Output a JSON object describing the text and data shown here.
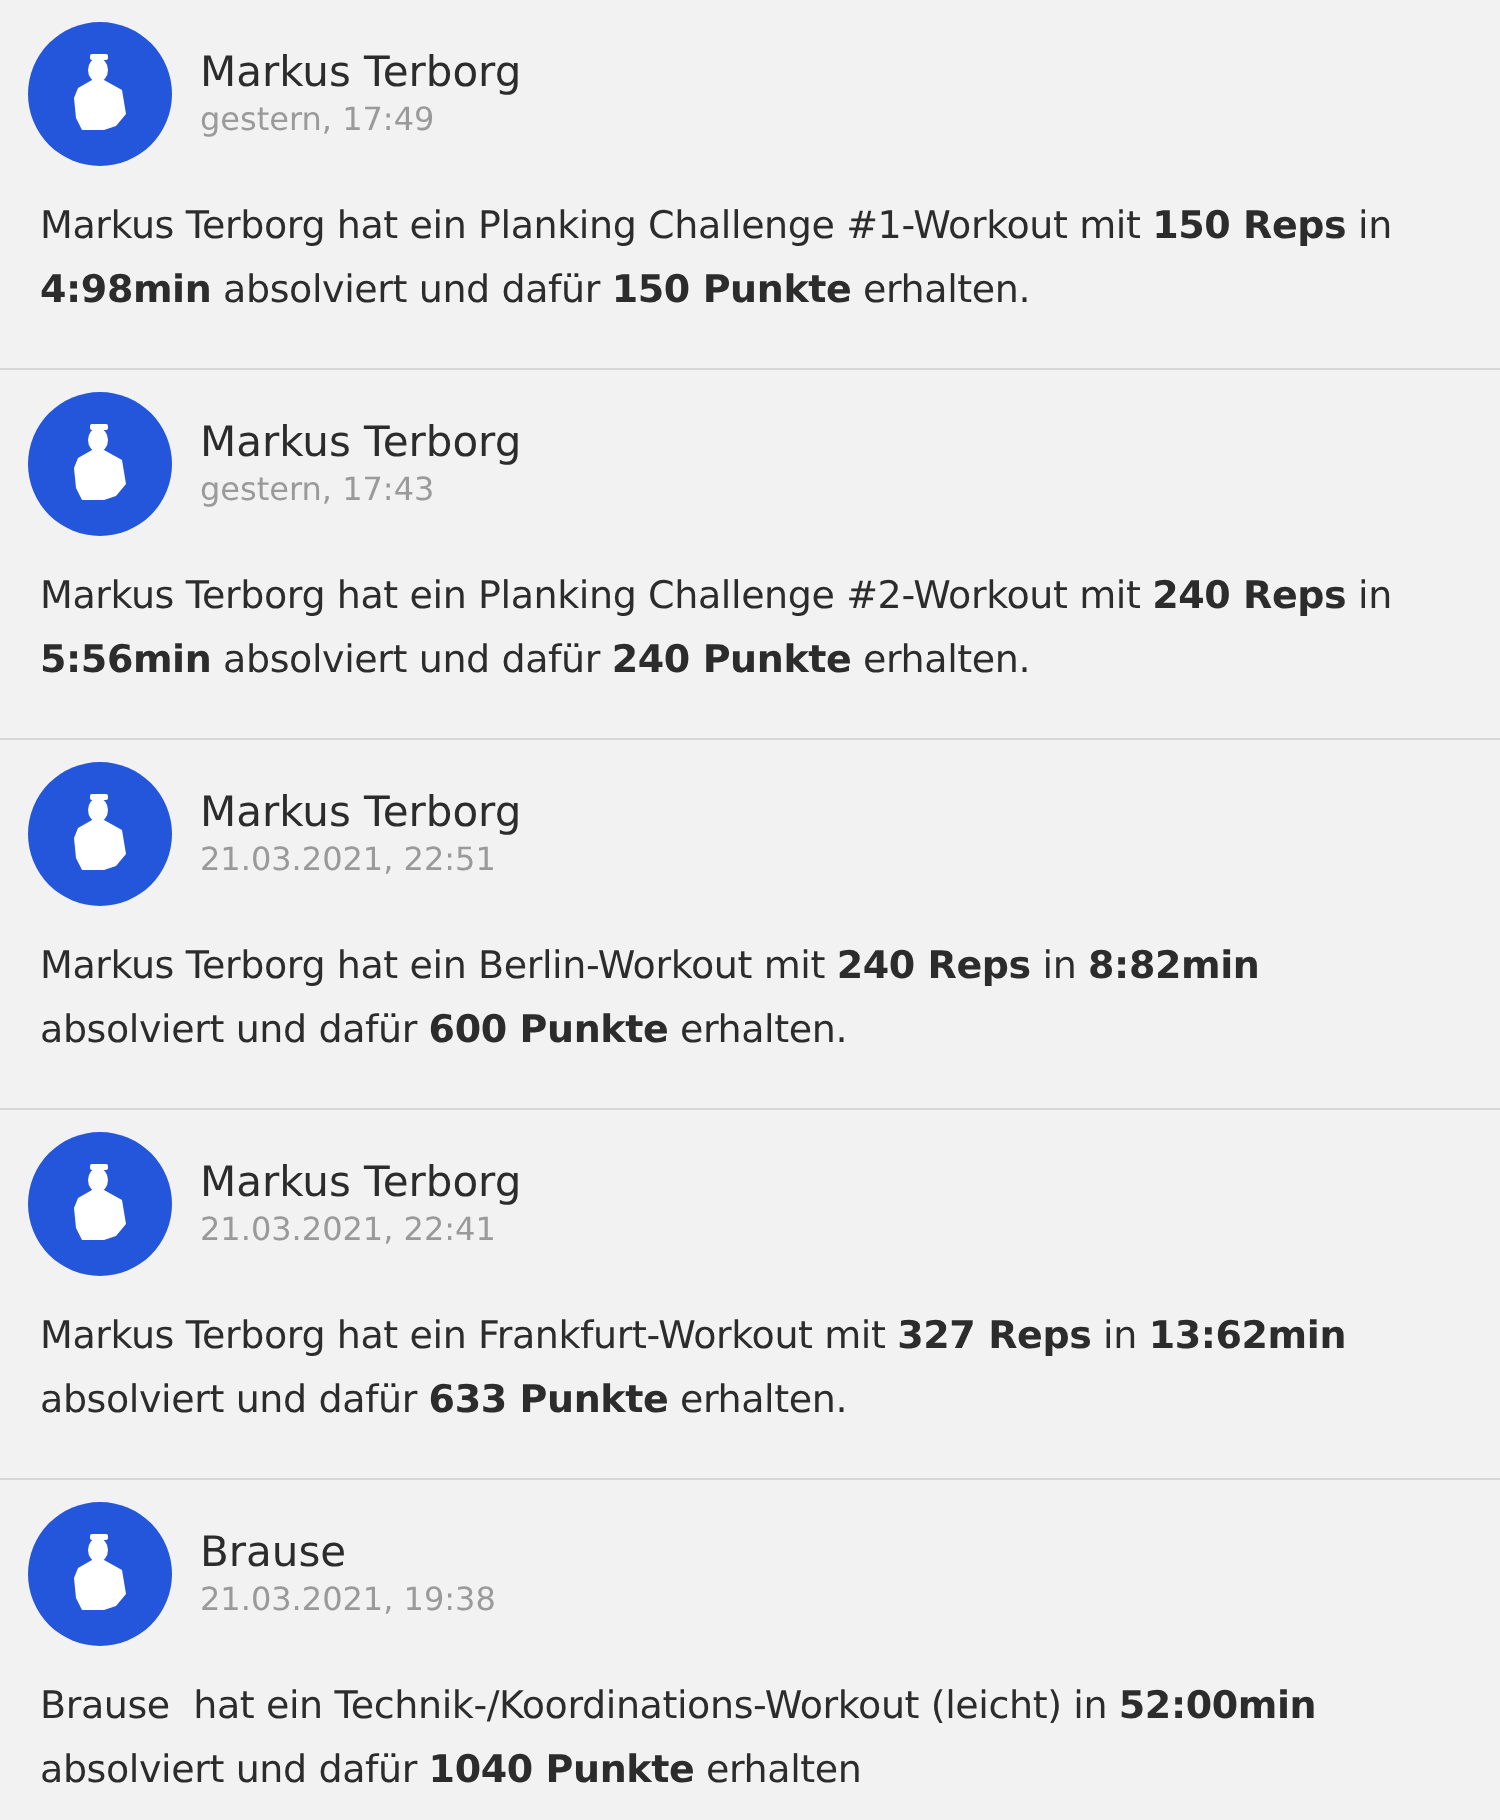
{
  "posts": [
    {
      "author": "Markus Terborg",
      "time": "gestern, 17:49",
      "text": "Markus Terborg hat ein Planking Challenge #1-Workout mit **150 Reps** in **4:98min** absolviert und dafür **150 Punkte** erhalten."
    },
    {
      "author": "Markus Terborg",
      "time": "gestern, 17:43",
      "text": "Markus Terborg hat ein Planking Challenge #2-Workout mit **240 Reps** in **5:56min** absolviert und dafür **240 Punkte** erhalten."
    },
    {
      "author": "Markus Terborg",
      "time": "21.03.2021, 22:51",
      "text": "Markus Terborg hat ein Berlin-Workout mit **240 Reps** in **8:82min** absolviert und dafür **600 Punkte** erhalten."
    },
    {
      "author": "Markus Terborg",
      "time": "21.03.2021, 22:41",
      "text": "Markus Terborg hat ein Frankfurt-Workout mit **327 Reps** in **13:62min** absolviert und dafür **633 Punkte** erhalten."
    },
    {
      "author": "Brause",
      "time": "21.03.2021, 19:38",
      "text": "Brause  hat ein Technik-/Koordinations-Workout (leicht) in **52:00min** absolviert und dafür **1040 Punkte** erhalten"
    }
  ]
}
